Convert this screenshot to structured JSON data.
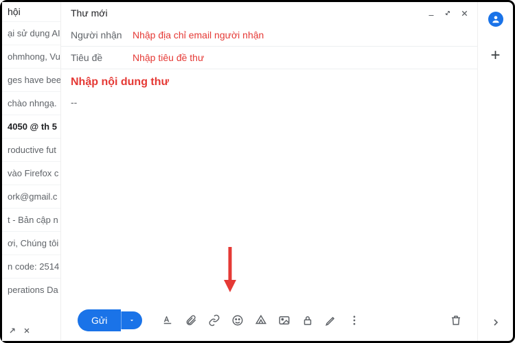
{
  "list": {
    "header": "hội",
    "items": [
      "ại sử dụng AI",
      "ohmhong, Vu",
      "ges have bee",
      "chào nhngạ.",
      "4050 @ th 5",
      "roductive fut",
      "vào Firefox c",
      "ork@gmail.c",
      "t - Bản cập n",
      "ơi, Chúng tôi",
      "n code: 2514",
      "perations Da"
    ]
  },
  "compose": {
    "title": "Thư mới",
    "to_label": "Người nhận",
    "to_hint": "Nhập địa chỉ email người nhận",
    "subject_label": "Tiêu đề",
    "subject_hint": "Nhập tiêu đề thư",
    "body_hint": "Nhập nội dung thư",
    "signature": "--",
    "send_label": "Gửi"
  },
  "colors": {
    "accent": "#1a73e8",
    "annotation": "#e53935"
  }
}
